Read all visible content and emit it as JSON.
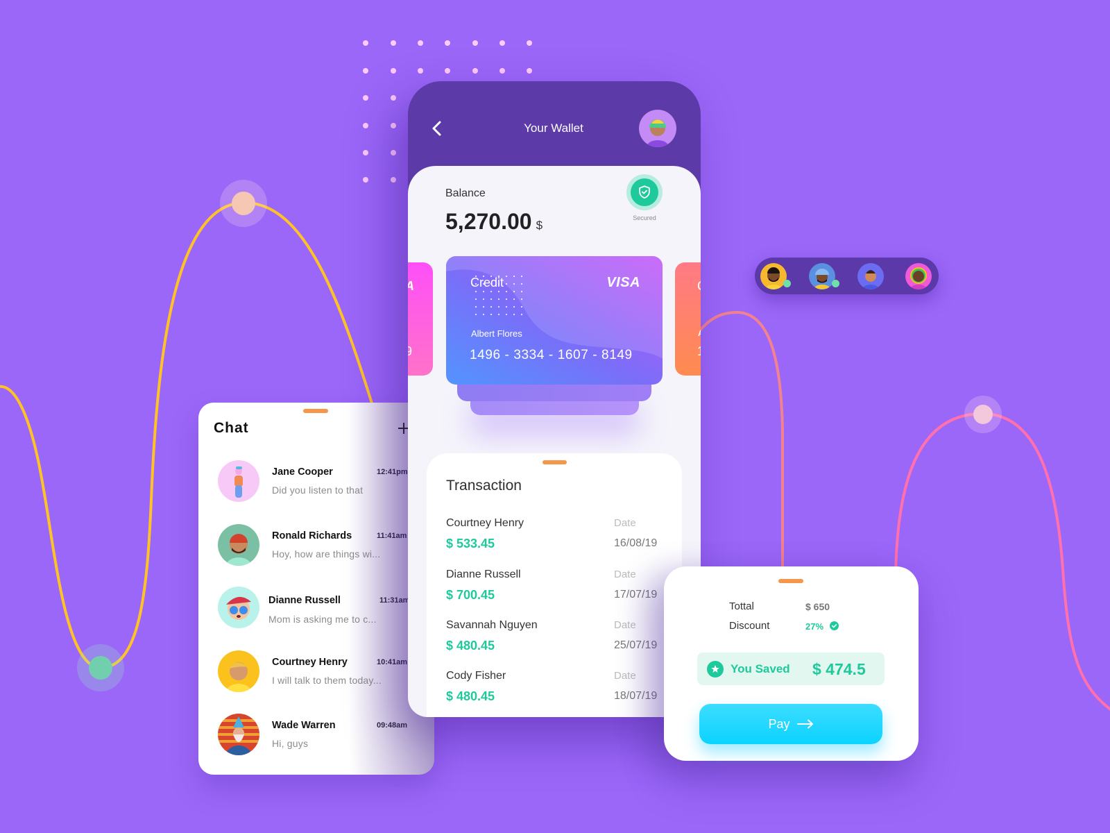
{
  "app": {
    "title": "Your Wallet"
  },
  "colors": {
    "background": "#9b67f9",
    "phone_header": "#5c3aa7",
    "accent_green": "#1ec99b",
    "pay_button": "#0bd3ff",
    "handle_orange": "#f5974a",
    "curve_yellow": "#ffc226",
    "curve_pink": "#ff70ad"
  },
  "icons": {
    "back": "chevron-left-icon",
    "secured": "shield-check-icon",
    "add_chat": "plus-icon",
    "discount_ok": "check-circle-icon",
    "saved": "star-circle-icon",
    "pay": "arrow-right-icon"
  },
  "wallet": {
    "header_title": "Your Wallet",
    "balance_label": "Balance",
    "balance_amount": "5,270.00",
    "balance_currency": "$",
    "secured_label": "Secured"
  },
  "card": {
    "type": "Credit",
    "brand": "VISA",
    "holder": "Albert Flores",
    "number": "1496 - 3334 - 1607 - 8149"
  },
  "peek_cards": {
    "left": {
      "brand_fragment": "A",
      "number_fragment": "9"
    },
    "right": {
      "type_fragment": "C",
      "holder_fragment": "A",
      "number_fragment": "1"
    }
  },
  "transactions": {
    "title": "Transaction",
    "date_label": "Date",
    "items": [
      {
        "name": "Courtney Henry",
        "amount": "$ 533.45",
        "date": "16/08/19"
      },
      {
        "name": "Dianne Russell",
        "amount": "$ 700.45",
        "date": "17/07/19"
      },
      {
        "name": "Savannah Nguyen",
        "amount": "$ 480.45",
        "date": "25/07/19"
      },
      {
        "name": "Cody Fisher",
        "amount": "$ 480.45",
        "date": "18/07/19"
      }
    ]
  },
  "chat": {
    "title": "Chat",
    "items": [
      {
        "name": "Jane Cooper",
        "message": "Did you listen to that",
        "time": "12:41pm"
      },
      {
        "name": "Ronald Richards",
        "message": "Hoy, how are things wi...",
        "time": "11:41am"
      },
      {
        "name": "Dianne Russell",
        "message": "Mom is asking me to c...",
        "time": "11:31am"
      },
      {
        "name": "Courtney Henry",
        "message": "I will talk to them today...",
        "time": "10:41am"
      },
      {
        "name": "Wade Warren",
        "message": "Hi, guys",
        "time": "09:48am"
      }
    ]
  },
  "payment": {
    "total_label": "Tottal",
    "total_value": "$ 650",
    "discount_label": "Discount",
    "discount_value": "27%",
    "saved_label": "You Saved",
    "saved_value": "$ 474.5",
    "pay_label": "Pay"
  },
  "contacts_bar": {
    "avatars": [
      {
        "online": true
      },
      {
        "online": true
      },
      {
        "online": false
      },
      {
        "online": false
      }
    ]
  }
}
